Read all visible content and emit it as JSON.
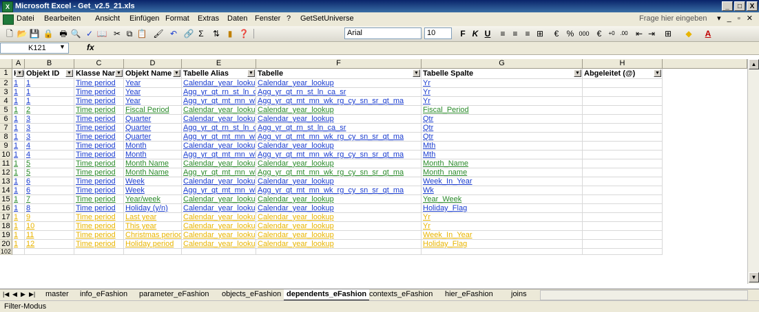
{
  "window": {
    "title": "Microsoft Excel - Get_v2.5_21.xls",
    "minimize": "_",
    "restore": "□",
    "close": "X"
  },
  "menu": [
    "Datei",
    "Bearbeiten",
    "Ansicht",
    "Einfügen",
    "Format",
    "Extras",
    "Daten",
    "Fenster",
    "?",
    "GetSetUniverse"
  ],
  "help_placeholder": "Frage hier eingeben",
  "toolbar": {
    "font": "Arial",
    "size": "10"
  },
  "formula": {
    "namebox": "K121",
    "fx": "fx",
    "content": ""
  },
  "columns": [
    "A",
    "B",
    "C",
    "D",
    "E",
    "F",
    "G",
    "H"
  ],
  "headers": [
    "Klasse ID",
    "Objekt ID",
    "Klasse Nam",
    "Objekt Name",
    "Tabelle Alias",
    "Tabelle",
    "Tabelle Spalte",
    "Abgeleitet (@)"
  ],
  "colors": {
    "blue": "#1a3ccf",
    "green": "#2a8a2a",
    "yellow": "#e8b400"
  },
  "rows": [
    {
      "n": "2",
      "c": "blue",
      "v": [
        "1",
        "1",
        "Time period",
        "Year",
        "Calendar_year_lookup",
        "Calendar_year_lookup",
        "Yr",
        ""
      ]
    },
    {
      "n": "3",
      "c": "blue",
      "v": [
        "1",
        "1",
        "Time period",
        "Year",
        "Agg_yr_qt_rn_st_ln_ca_sr",
        "Agg_yr_qt_rn_st_ln_ca_sr",
        "Yr",
        ""
      ]
    },
    {
      "n": "4",
      "c": "blue",
      "v": [
        "1",
        "1",
        "Time period",
        "Year",
        "Agg_yr_qt_mt_mn_wk_rg_cy_sn_sr_qt_ma",
        "Agg_yr_qt_mt_mn_wk_rg_cy_sn_sr_qt_ma",
        "Yr",
        ""
      ]
    },
    {
      "n": "5",
      "c": "green",
      "v": [
        "1",
        "2",
        "Time period",
        "Fiscal Period",
        "Calendar_year_lookup",
        "Calendar_year_lookup",
        "Fiscal_Period",
        ""
      ]
    },
    {
      "n": "6",
      "c": "blue",
      "v": [
        "1",
        "3",
        "Time period",
        "Quarter",
        "Calendar_year_lookup",
        "Calendar_year_lookup",
        "Qtr",
        ""
      ]
    },
    {
      "n": "7",
      "c": "blue",
      "v": [
        "1",
        "3",
        "Time period",
        "Quarter",
        "Agg_yr_qt_rn_st_ln_ca_sr",
        "Agg_yr_qt_rn_st_ln_ca_sr",
        "Qtr",
        ""
      ]
    },
    {
      "n": "8",
      "c": "blue",
      "v": [
        "1",
        "3",
        "Time period",
        "Quarter",
        "Agg_yr_qt_mt_mn_wk_rg_cy_sn_sr_qt_ma",
        "Agg_yr_qt_mt_mn_wk_rg_cy_sn_sr_qt_ma",
        "Qtr",
        ""
      ]
    },
    {
      "n": "9",
      "c": "blue",
      "v": [
        "1",
        "4",
        "Time period",
        "Month",
        "Calendar_year_lookup",
        "Calendar_year_lookup",
        "Mth",
        ""
      ]
    },
    {
      "n": "10",
      "c": "blue",
      "v": [
        "1",
        "4",
        "Time period",
        "Month",
        "Agg_yr_qt_mt_mn_wk_rg_cy_sn_sr_qt_ma",
        "Agg_yr_qt_mt_mn_wk_rg_cy_sn_sr_qt_ma",
        "Mth",
        ""
      ]
    },
    {
      "n": "11",
      "c": "green",
      "v": [
        "1",
        "5",
        "Time period",
        "Month Name",
        "Calendar_year_lookup",
        "Calendar_year_lookup",
        "Month_Name",
        ""
      ]
    },
    {
      "n": "12",
      "c": "green",
      "v": [
        "1",
        "5",
        "Time period",
        "Month Name",
        "Agg_yr_qt_mt_mn_wk_rg_cy_sn_sr_qt_ma",
        "Agg_yr_qt_mt_mn_wk_rg_cy_sn_sr_qt_ma",
        "Month_name",
        ""
      ]
    },
    {
      "n": "13",
      "c": "blue",
      "v": [
        "1",
        "6",
        "Time period",
        "Week",
        "Calendar_year_lookup",
        "Calendar_year_lookup",
        "Week_In_Year",
        ""
      ]
    },
    {
      "n": "14",
      "c": "blue",
      "v": [
        "1",
        "6",
        "Time period",
        "Week",
        "Agg_yr_qt_mt_mn_wk_rg_cy_sn_sr_qt_ma",
        "Agg_yr_qt_mt_mn_wk_rg_cy_sn_sr_qt_ma",
        "Wk",
        ""
      ]
    },
    {
      "n": "15",
      "c": "green",
      "v": [
        "1",
        "7",
        "Time period",
        "Year/week",
        "Calendar_year_lookup",
        "Calendar_year_lookup",
        "Year_Week",
        ""
      ]
    },
    {
      "n": "16",
      "c": "blue",
      "v": [
        "1",
        "8",
        "Time period",
        "Holiday (y/n)",
        "Calendar_year_lookup",
        "Calendar_year_lookup",
        "Holiday_Flag",
        ""
      ]
    },
    {
      "n": "17",
      "c": "yellow",
      "v": [
        "1",
        "9",
        "Time period",
        "Last year",
        "Calendar_year_lookup",
        "Calendar_year_lookup",
        "Yr",
        ""
      ]
    },
    {
      "n": "18",
      "c": "yellow",
      "v": [
        "1",
        "10",
        "Time period",
        "This year",
        "Calendar_year_lookup",
        "Calendar_year_lookup",
        "Yr",
        ""
      ]
    },
    {
      "n": "19",
      "c": "yellow",
      "v": [
        "1",
        "11",
        "Time period",
        "Christmas period",
        "Calendar_year_lookup",
        "Calendar_year_lookup",
        "Week_In_Year",
        ""
      ]
    },
    {
      "n": "20",
      "c": "yellow",
      "v": [
        "1",
        "12",
        "Time period",
        "Holiday period",
        "Calendar_year_lookup",
        "Calendar_year_lookup",
        "Holiday_Flag",
        ""
      ]
    },
    {
      "n": "102",
      "c": "blue",
      "v": [
        "",
        "",
        "",
        "",
        "",
        "",
        "",
        ""
      ]
    }
  ],
  "sheets": [
    "master",
    "info_eFashion",
    "parameter_eFashion",
    "objects_eFashion",
    "dependents_eFashion",
    "contexts_eFashion",
    "hier_eFashion",
    "joins"
  ],
  "active_sheet": "dependents_eFashion",
  "status": "Filter-Modus"
}
